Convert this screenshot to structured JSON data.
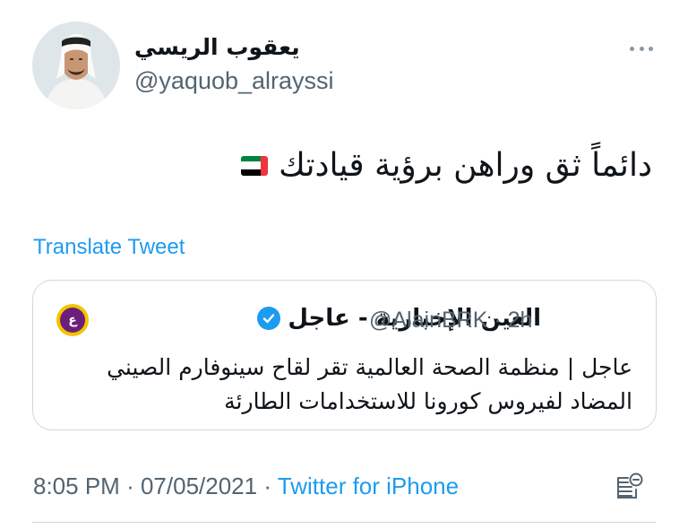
{
  "author": {
    "display_name": "يعقوب الريسي",
    "handle": "@yaquob_alrayssi",
    "avatar": "avatar-photo"
  },
  "tweet": {
    "text": "دائماً ثق وراهن برؤية قيادتك",
    "emoji": "uae-flag-icon",
    "translate_label": "Translate Tweet"
  },
  "quoted": {
    "display_name": "العين الإخبارية - عاجل",
    "handle": "@AlainBRK",
    "separator": "·",
    "age": "2h",
    "avatar_letter": "ع",
    "text_lines": [
      "عاجل | منظمة الصحة العالمية تقر لقاح سينوفارم الصيني",
      "المضاد لفيروس كورونا للاستخدامات الطارئة"
    ]
  },
  "footer": {
    "time": "8:05 PM",
    "separator": "·",
    "date": "07/05/2021",
    "source": "Twitter for iPhone"
  },
  "colors": {
    "link": "#1d9bf0",
    "muted": "#536471",
    "text": "#0f1419",
    "border": "#cfd9de"
  },
  "icons": [
    "more-icon",
    "verified-icon",
    "analytics-icon",
    "uae-flag-icon"
  ]
}
